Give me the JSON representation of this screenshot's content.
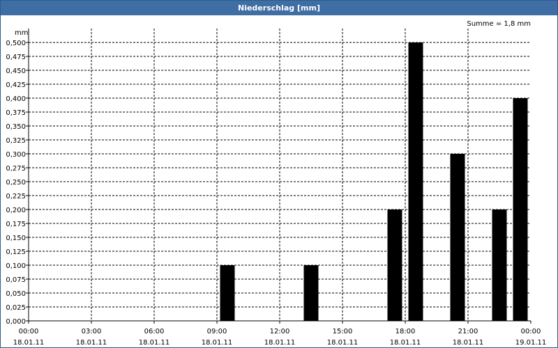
{
  "window": {
    "title": "Niederschlag [mm]"
  },
  "summary": "Summe = 1,8 mm",
  "chart_data": {
    "type": "bar",
    "title": "Niederschlag [mm]",
    "ylabel": "mm",
    "ylim": [
      0,
      0.5
    ],
    "y_ticks": [
      "0,000",
      "0,025",
      "0,050",
      "0,075",
      "0,100",
      "0,125",
      "0,150",
      "0,175",
      "0,200",
      "0,225",
      "0,250",
      "0,275",
      "0,300",
      "0,325",
      "0,350",
      "0,375",
      "0,400",
      "0,425",
      "0,450",
      "0,475",
      "0,500"
    ],
    "x_ticks": [
      {
        "time": "00:00",
        "date": "18.01.11"
      },
      {
        "time": "03:00",
        "date": "18.01.11"
      },
      {
        "time": "06:00",
        "date": "18.01.11"
      },
      {
        "time": "09:00",
        "date": "18.01.11"
      },
      {
        "time": "12:00",
        "date": "18.01.11"
      },
      {
        "time": "15:00",
        "date": "18.01.11"
      },
      {
        "time": "18:00",
        "date": "18.01.11"
      },
      {
        "time": "21:00",
        "date": "18.01.11"
      },
      {
        "time": "00:00",
        "date": "19.01.11"
      }
    ],
    "x_hours_range": [
      0,
      24
    ],
    "bar_color": "#000000",
    "bars": [
      {
        "hour": 9.5,
        "value": 0.1
      },
      {
        "hour": 13.5,
        "value": 0.1
      },
      {
        "hour": 17.5,
        "value": 0.2
      },
      {
        "hour": 18.5,
        "value": 0.5
      },
      {
        "hour": 20.5,
        "value": 0.3
      },
      {
        "hour": 22.5,
        "value": 0.2
      },
      {
        "hour": 23.5,
        "value": 0.4
      }
    ],
    "grid": true
  }
}
